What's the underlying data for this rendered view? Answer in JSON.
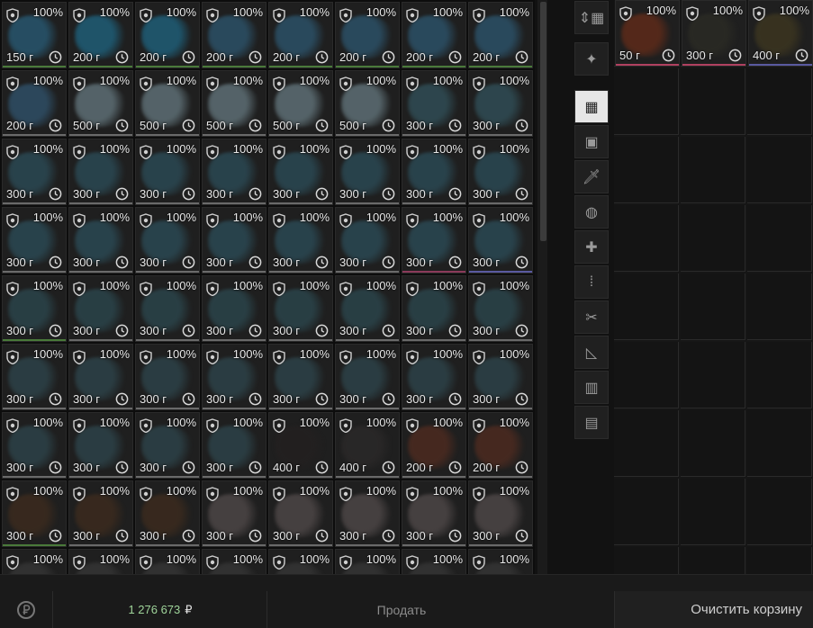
{
  "items": [
    {
      "pct": "100%",
      "weight": "150 г",
      "color": "#27536a",
      "line": "#4a7a3a"
    },
    {
      "pct": "100%",
      "weight": "200 г",
      "color": "#1f5a72",
      "line": "#4a7a3a"
    },
    {
      "pct": "100%",
      "weight": "200 г",
      "color": "#1f5a72",
      "line": "#4a7a3a"
    },
    {
      "pct": "100%",
      "weight": "200 г",
      "color": "#2b4e63",
      "line": "#4a7a3a"
    },
    {
      "pct": "100%",
      "weight": "200 г",
      "color": "#2b4e63",
      "line": "#4a7a3a"
    },
    {
      "pct": "100%",
      "weight": "200 г",
      "color": "#2b4e63",
      "line": "#4a7a3a"
    },
    {
      "pct": "100%",
      "weight": "200 г",
      "color": "#2b4e63",
      "line": "#4a7a3a"
    },
    {
      "pct": "100%",
      "weight": "200 г",
      "color": "#2b4e63",
      "line": "#4a7a3a"
    },
    {
      "pct": "100%",
      "weight": "200 г",
      "color": "#2e4c62",
      "line": "#6a6a6a"
    },
    {
      "pct": "100%",
      "weight": "500 г",
      "color": "#5a6a70",
      "line": "#6a6a6a"
    },
    {
      "pct": "100%",
      "weight": "500 г",
      "color": "#5a6a70",
      "line": "#6a6a6a"
    },
    {
      "pct": "100%",
      "weight": "500 г",
      "color": "#5a6a70",
      "line": "#6a6a6a"
    },
    {
      "pct": "100%",
      "weight": "500 г",
      "color": "#5a6a70",
      "line": "#6a6a6a"
    },
    {
      "pct": "100%",
      "weight": "500 г",
      "color": "#5a6a70",
      "line": "#6a6a6a"
    },
    {
      "pct": "100%",
      "weight": "300 г",
      "color": "#2f4a52",
      "line": "#6a6a6a"
    },
    {
      "pct": "100%",
      "weight": "300 г",
      "color": "#2f4a52",
      "line": "#6a6a6a"
    },
    {
      "pct": "100%",
      "weight": "300 г",
      "color": "#2a4650",
      "line": "#6a6a6a"
    },
    {
      "pct": "100%",
      "weight": "300 г",
      "color": "#2a4650",
      "line": "#6a6a6a"
    },
    {
      "pct": "100%",
      "weight": "300 г",
      "color": "#2a4650",
      "line": "#6a6a6a"
    },
    {
      "pct": "100%",
      "weight": "300 г",
      "color": "#2a4650",
      "line": "#6a6a6a"
    },
    {
      "pct": "100%",
      "weight": "300 г",
      "color": "#2a4650",
      "line": "#6a6a6a"
    },
    {
      "pct": "100%",
      "weight": "300 г",
      "color": "#2a4650",
      "line": "#6a6a6a"
    },
    {
      "pct": "100%",
      "weight": "300 г",
      "color": "#2a4650",
      "line": "#6a6a6a"
    },
    {
      "pct": "100%",
      "weight": "300 г",
      "color": "#2a4650",
      "line": "#6a6a6a"
    },
    {
      "pct": "100%",
      "weight": "300 г",
      "color": "#2a4650",
      "line": "#6a6a6a"
    },
    {
      "pct": "100%",
      "weight": "300 г",
      "color": "#2a4650",
      "line": "#6a6a6a"
    },
    {
      "pct": "100%",
      "weight": "300 г",
      "color": "#2a4650",
      "line": "#6a6a6a"
    },
    {
      "pct": "100%",
      "weight": "300 г",
      "color": "#2a4650",
      "line": "#6a6a6a"
    },
    {
      "pct": "100%",
      "weight": "300 г",
      "color": "#2a4650",
      "line": "#6a6a6a"
    },
    {
      "pct": "100%",
      "weight": "300 г",
      "color": "#2a4650",
      "line": "#6a6a6a"
    },
    {
      "pct": "100%",
      "weight": "300 г",
      "color": "#2a4650",
      "line": "#8a3a5a"
    },
    {
      "pct": "100%",
      "weight": "300 г",
      "color": "#2a4650",
      "line": "#5a5aa0"
    },
    {
      "pct": "100%",
      "weight": "300 г",
      "color": "#2a4248",
      "line": "#4a7a3a"
    },
    {
      "pct": "100%",
      "weight": "300 г",
      "color": "#2a4248",
      "line": "#6a6a6a"
    },
    {
      "pct": "100%",
      "weight": "300 г",
      "color": "#2a4248",
      "line": "#6a6a6a"
    },
    {
      "pct": "100%",
      "weight": "300 г",
      "color": "#2a4248",
      "line": "#6a6a6a"
    },
    {
      "pct": "100%",
      "weight": "300 г",
      "color": "#2a4248",
      "line": "#6a6a6a"
    },
    {
      "pct": "100%",
      "weight": "300 г",
      "color": "#2a4248",
      "line": "#6a6a6a"
    },
    {
      "pct": "100%",
      "weight": "300 г",
      "color": "#2a4248",
      "line": "#6a6a6a"
    },
    {
      "pct": "100%",
      "weight": "300 г",
      "color": "#2a4248",
      "line": "#6a6a6a"
    },
    {
      "pct": "100%",
      "weight": "300 г",
      "color": "#2c4046",
      "line": "#6a6a6a"
    },
    {
      "pct": "100%",
      "weight": "300 г",
      "color": "#2c4046",
      "line": "#6a6a6a"
    },
    {
      "pct": "100%",
      "weight": "300 г",
      "color": "#2c4046",
      "line": "#6a6a6a"
    },
    {
      "pct": "100%",
      "weight": "300 г",
      "color": "#2c4046",
      "line": "#6a6a6a"
    },
    {
      "pct": "100%",
      "weight": "300 г",
      "color": "#2c4046",
      "line": "#6a6a6a"
    },
    {
      "pct": "100%",
      "weight": "300 г",
      "color": "#2c4046",
      "line": "#6a6a6a"
    },
    {
      "pct": "100%",
      "weight": "300 г",
      "color": "#2c4046",
      "line": "#6a6a6a"
    },
    {
      "pct": "100%",
      "weight": "300 г",
      "color": "#2c4046",
      "line": "#6a6a6a"
    },
    {
      "pct": "100%",
      "weight": "300 г",
      "color": "#2c4046",
      "line": "#6a6a6a"
    },
    {
      "pct": "100%",
      "weight": "300 г",
      "color": "#2c4046",
      "line": "#6a6a6a"
    },
    {
      "pct": "100%",
      "weight": "300 г",
      "color": "#2c4046",
      "line": "#6a6a6a"
    },
    {
      "pct": "100%",
      "weight": "300 г",
      "color": "#2c4046",
      "line": "#6a6a6a"
    },
    {
      "pct": "100%",
      "weight": "400 г",
      "color": "#232020",
      "line": "#6a6a6a"
    },
    {
      "pct": "100%",
      "weight": "400 г",
      "color": "#2a2828",
      "line": "#6a6a6a"
    },
    {
      "pct": "100%",
      "weight": "200 г",
      "color": "#4a2a20",
      "line": "#6a6a6a"
    },
    {
      "pct": "100%",
      "weight": "200 г",
      "color": "#4a2a20",
      "line": "#6a6a6a"
    },
    {
      "pct": "100%",
      "weight": "300 г",
      "color": "#3a2a1e",
      "line": "#4a7a3a"
    },
    {
      "pct": "100%",
      "weight": "300 г",
      "color": "#3a2a1e",
      "line": "#6a6a6a"
    },
    {
      "pct": "100%",
      "weight": "300 г",
      "color": "#3a2a1e",
      "line": "#6a6a6a"
    },
    {
      "pct": "100%",
      "weight": "300 г",
      "color": "#4a4444",
      "line": "#6a6a6a"
    },
    {
      "pct": "100%",
      "weight": "300 г",
      "color": "#4a4444",
      "line": "#6a6a6a"
    },
    {
      "pct": "100%",
      "weight": "300 г",
      "color": "#4a4444",
      "line": "#6a6a6a"
    },
    {
      "pct": "100%",
      "weight": "300 г",
      "color": "#4a4444",
      "line": "#6a6a6a"
    },
    {
      "pct": "100%",
      "weight": "300 г",
      "color": "#4a4444",
      "line": "#6a6a6a"
    },
    {
      "pct": "100%",
      "weight": "",
      "color": "#333",
      "line": ""
    },
    {
      "pct": "100%",
      "weight": "",
      "color": "#333",
      "line": ""
    },
    {
      "pct": "100%",
      "weight": "",
      "color": "#333",
      "line": ""
    },
    {
      "pct": "100%",
      "weight": "",
      "color": "#333",
      "line": ""
    },
    {
      "pct": "100%",
      "weight": "",
      "color": "#333",
      "line": ""
    },
    {
      "pct": "100%",
      "weight": "",
      "color": "#333",
      "line": ""
    },
    {
      "pct": "100%",
      "weight": "",
      "color": "#333",
      "line": ""
    },
    {
      "pct": "100%",
      "weight": "",
      "color": "#333",
      "line": ""
    }
  ],
  "sidebar": [
    {
      "icon": "sort-icon",
      "glyph": "⇕▦",
      "active": false
    },
    {
      "icon": "favorite-star-icon",
      "glyph": "✦",
      "active": false
    },
    {
      "icon": "all-items-grid-icon",
      "glyph": "▦",
      "active": true
    },
    {
      "icon": "backpack-icon",
      "glyph": "▣",
      "active": false
    },
    {
      "icon": "knife-icon",
      "glyph": "🗡",
      "active": false
    },
    {
      "icon": "globe-artifact-icon",
      "glyph": "◍",
      "active": false
    },
    {
      "icon": "medkit-icon",
      "glyph": "✚",
      "active": false
    },
    {
      "icon": "ammo-icon",
      "glyph": "⁞",
      "active": false
    },
    {
      "icon": "tools-icon",
      "glyph": "✂",
      "active": false
    },
    {
      "icon": "ruler-triangle-icon",
      "glyph": "◺",
      "active": false
    },
    {
      "icon": "container-icon",
      "glyph": "▥",
      "active": false
    },
    {
      "icon": "archive-box-icon",
      "glyph": "▤",
      "active": false
    }
  ],
  "cart": {
    "items": [
      {
        "pct": "100%",
        "weight": "50 г",
        "color": "#5a2a1a",
        "line": "#b04060"
      },
      {
        "pct": "100%",
        "weight": "300 г",
        "color": "#2a2a24",
        "line": "#b04060"
      },
      {
        "pct": "100%",
        "weight": "400 г",
        "color": "#3a3420",
        "line": "#5a5aa0"
      }
    ],
    "clear_label": "Очистить корзину"
  },
  "footer": {
    "balance": "1 276 673",
    "currency": "₽",
    "sell_label": "Продать"
  }
}
